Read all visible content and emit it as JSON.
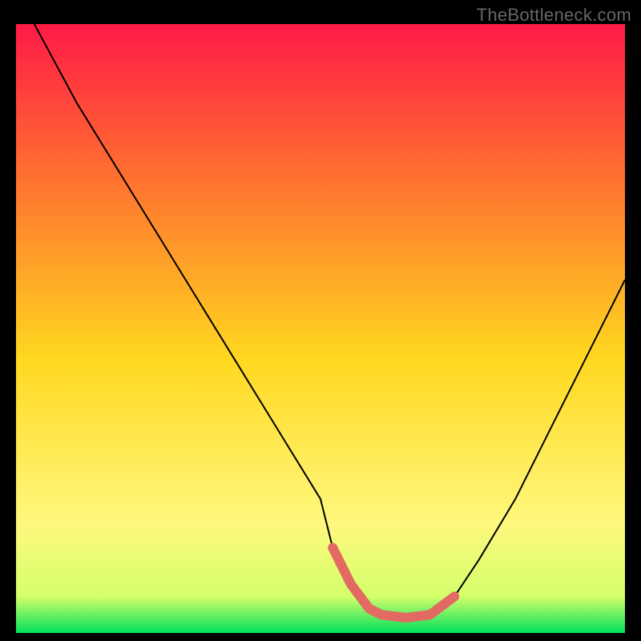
{
  "watermark": "TheBottleneck.com",
  "chart_data": {
    "type": "line",
    "title": "",
    "xlabel": "",
    "ylabel": "",
    "xlim": [
      0,
      100
    ],
    "ylim": [
      0,
      100
    ],
    "background_gradient_top": "#ff1a45",
    "background_gradient_mid_upper": "#ff7a2e",
    "background_gradient_mid": "#ffd81f",
    "background_gradient_mid_lower": "#fff87e",
    "background_gradient_bottom": "#00e05a",
    "series": [
      {
        "name": "bottleneck-curve",
        "color": "#000000",
        "stroke_width": 2,
        "x": [
          3,
          10,
          18,
          26,
          34,
          42,
          50,
          52,
          55,
          58,
          60,
          64,
          68,
          72,
          76,
          82,
          88,
          94,
          100
        ],
        "y": [
          100,
          87,
          74,
          61,
          48,
          35,
          22,
          14,
          8,
          4,
          3,
          2.5,
          3,
          6,
          12,
          22,
          34,
          46,
          58
        ]
      }
    ],
    "highlight_segment": {
      "color": "#e26a63",
      "stroke_width": 12,
      "linecap": "round",
      "x": [
        52,
        55,
        58,
        60,
        64,
        68,
        72
      ],
      "y": [
        14,
        8,
        4,
        3,
        2.5,
        3,
        6
      ]
    }
  }
}
